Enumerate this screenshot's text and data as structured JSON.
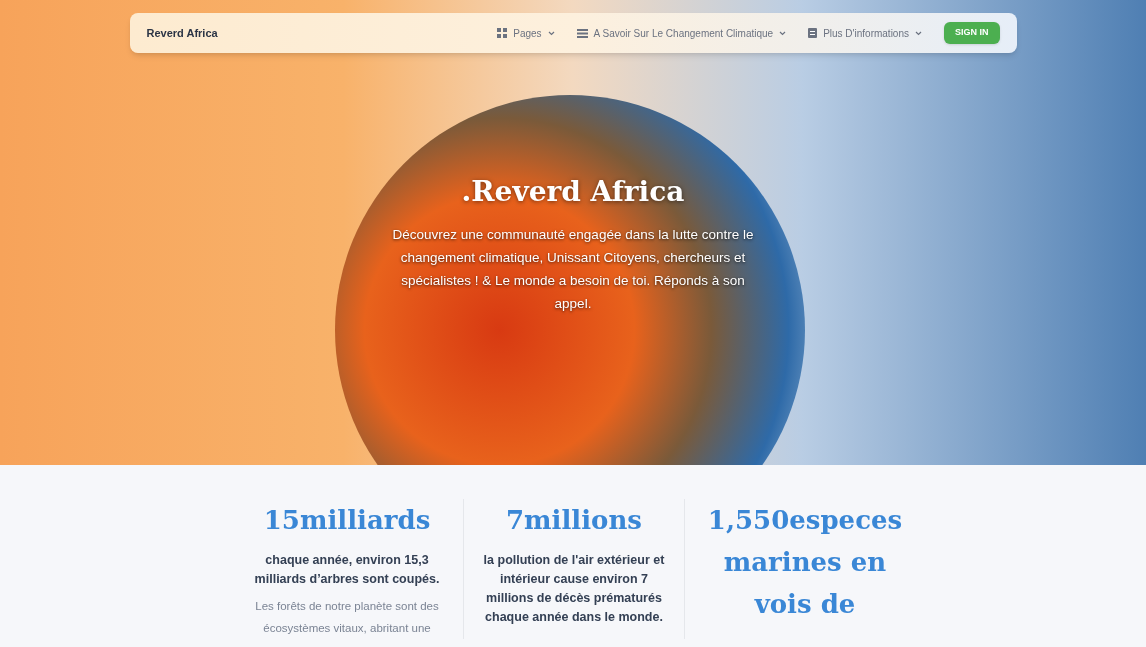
{
  "navbar": {
    "brand": "Reverd Africa",
    "items": [
      {
        "label": "Pages"
      },
      {
        "label": "A Savoir Sur Le Changement Climatique"
      },
      {
        "label": "Plus D'informations"
      }
    ],
    "button": "SIGN IN"
  },
  "hero": {
    "title": ".Reverd Africa",
    "text": "Découvrez une communauté engagée dans la lutte contre le changement climatique, Unissant Citoyens, chercheurs et spécialistes ! & Le monde a besoin de toi. Réponds à son appel."
  },
  "stats": [
    {
      "number": "15milliards",
      "headline": "chaque année, environ 15,3 milliards d’arbres sont coupés.",
      "body": "Les forêts de notre planète sont des écosystèmes vitaux, abritant une"
    },
    {
      "number": "7millions",
      "headline": "la pollution de l'air extérieur et intérieur cause environ 7 millions de décès prématurés chaque année dans le monde."
    },
    {
      "number": "1,550especes marines en vois de"
    }
  ]
}
